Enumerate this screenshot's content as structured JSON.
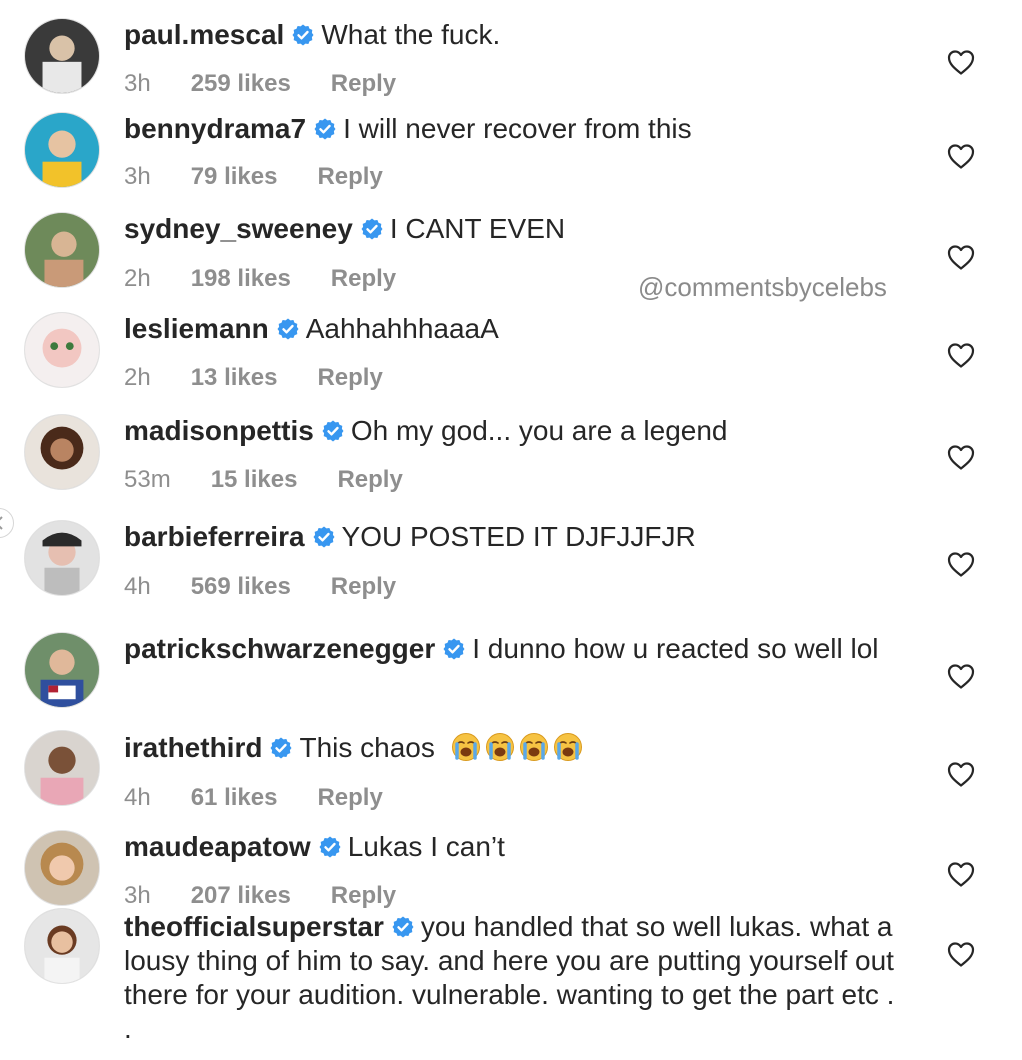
{
  "watermark": "@commentsbycelebs",
  "icons": {
    "verified": "verified-badge-icon",
    "like": "heart-outline-icon",
    "emoji": "loudly-crying-face-emoji",
    "nav": "chevron-left-icon"
  },
  "colors": {
    "verified": "#3897f0",
    "meta": "#8e8e8e",
    "text": "#262626"
  },
  "comments": [
    {
      "username": "paul.mescal",
      "text": "What the fuck.",
      "time": "3h",
      "likes": "259 likes",
      "reply": "Reply"
    },
    {
      "username": "bennydrama7",
      "text": "I will never recover from this",
      "time": "3h",
      "likes": "79 likes",
      "reply": "Reply"
    },
    {
      "username": "sydney_sweeney",
      "text": "I CANT EVEN",
      "time": "2h",
      "likes": "198 likes",
      "reply": "Reply"
    },
    {
      "username": "lesliemann",
      "text": "AahhahhhaaaA",
      "time": "2h",
      "likes": "13 likes",
      "reply": "Reply"
    },
    {
      "username": "madisonpettis",
      "text": "Oh my god... you are a legend",
      "time": "53m",
      "likes": "15 likes",
      "reply": "Reply"
    },
    {
      "username": "barbieferreira",
      "text": "YOU POSTED IT DJFJJFJR",
      "time": "4h",
      "likes": "569 likes",
      "reply": "Reply"
    },
    {
      "username": "patrickschwarzenegger",
      "text": "I dunno how u reacted so well lol"
    },
    {
      "username": "irathethird",
      "text": "This chaos",
      "emoji_count": 4,
      "time": "4h",
      "likes": "61 likes",
      "reply": "Reply"
    },
    {
      "username": "maudeapatow",
      "text": "Lukas I can’t",
      "time": "3h",
      "likes": "207 likes",
      "reply": "Reply"
    },
    {
      "username": "theofficialsuperstar",
      "text": "you handled that so well lukas. what a lousy thing of him to say.  and here you are putting yourself out there for your audition. vulnerable. wanting to get the part etc . ."
    }
  ]
}
